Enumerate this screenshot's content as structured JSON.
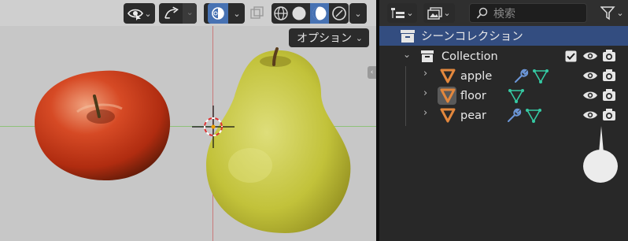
{
  "viewport": {
    "options_label": "オプション",
    "options_caret": "⌄"
  },
  "outliner": {
    "search_placeholder": "検索",
    "scene_collection": "シーンコレクション",
    "collection": "Collection",
    "objects": [
      {
        "name": "apple",
        "has_modifier": true,
        "has_mesh_data": true
      },
      {
        "name": "floor",
        "has_modifier": false,
        "has_mesh_data": true
      },
      {
        "name": "pear",
        "has_modifier": true,
        "has_mesh_data": true
      }
    ]
  },
  "colors": {
    "selected_row": "#334d80",
    "active_button": "#4772b3",
    "object_icon": "#e2873d",
    "mesh_icon": "#35c9a3",
    "modifier_icon": "#6c97d9"
  }
}
